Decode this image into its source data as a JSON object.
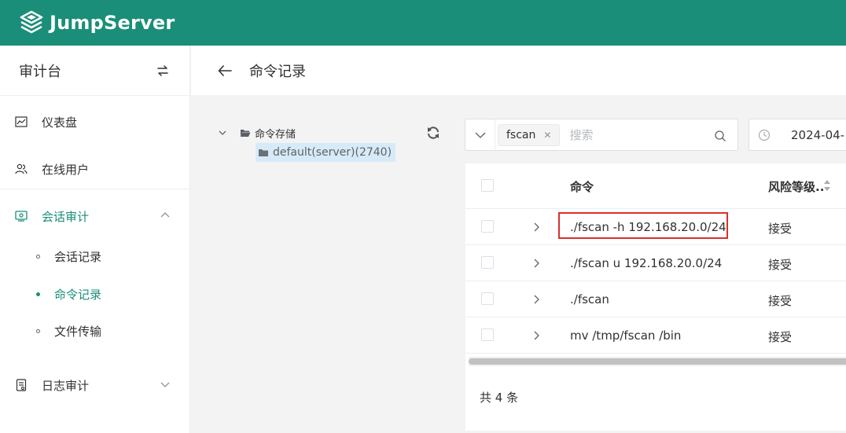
{
  "brand": {
    "name": "JumpServer",
    "topbar_color": "#1a8e78"
  },
  "sidebar": {
    "title": "审计台",
    "items": [
      {
        "label": "仪表盘",
        "icon": "chart-icon"
      },
      {
        "label": "在线用户",
        "icon": "users-icon"
      },
      {
        "label": "会话审计",
        "icon": "session-audit-icon",
        "expanded": true,
        "children": [
          {
            "label": "会话记录"
          },
          {
            "label": "命令记录",
            "active": true
          },
          {
            "label": "文件传输"
          }
        ]
      },
      {
        "label": "日志审计",
        "icon": "log-audit-icon",
        "expanded": false
      }
    ]
  },
  "page": {
    "title": "命令记录"
  },
  "tree": {
    "root_label": "命令存储",
    "child_label": "default(server)(2740)"
  },
  "search": {
    "tag": "fscan",
    "placeholder": "搜索"
  },
  "date_filter": {
    "value": "2024-04-"
  },
  "table": {
    "columns": [
      "命令",
      "风险等级.."
    ],
    "rows": [
      {
        "command": "./fscan -h 192.168.20.0/24",
        "risk": "接受"
      },
      {
        "command": "./fscan u 192.168.20.0/24",
        "risk": "接受"
      },
      {
        "command": "./fscan",
        "risk": "接受"
      },
      {
        "command": "mv /tmp/fscan /bin",
        "risk": "接受"
      }
    ],
    "total_text": "共 4 条"
  },
  "colors": {
    "accent": "#1a8e78",
    "highlight_border": "#d9302c"
  }
}
